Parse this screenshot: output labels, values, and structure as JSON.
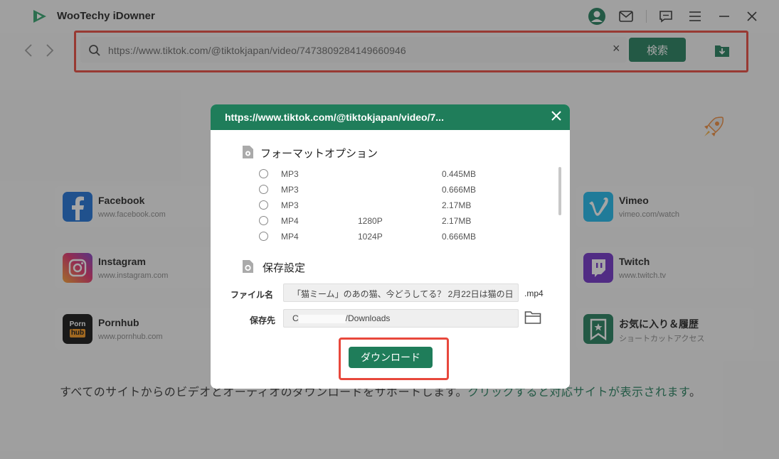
{
  "app": {
    "title": "WooTechy iDowner"
  },
  "colors": {
    "accent": "#1f7d5a",
    "highlight": "#e8483c"
  },
  "search": {
    "value": "https://www.tiktok.com/@tiktokjapan/video/7473809284149660946",
    "button_label": "検索"
  },
  "sites": [
    {
      "name": "Facebook",
      "url": "www.facebook.com",
      "icon": "facebook-icon"
    },
    {
      "name": "Instagram",
      "url": "www.instagram.com",
      "icon": "instagram-icon"
    },
    {
      "name": "Pornhub",
      "url": "www.pornhub.com",
      "icon": "pornhub-icon",
      "logo_top": "Porn",
      "logo_bottom": "hub"
    },
    {
      "name": "Vimeo",
      "url": "vimeo.com/watch",
      "icon": "vimeo-icon"
    },
    {
      "name": "Twitch",
      "url": "www.twitch.tv",
      "icon": "twitch-icon"
    },
    {
      "name": "お気に入り＆履歴",
      "url": "ショートカットアクセス",
      "icon": "bookmark-icon"
    }
  ],
  "footer": {
    "text": "すべてのサイトからのビデオとオーディオのダウンロードをサポートします。",
    "link_text": "クリックすると対応サイトが表示されます",
    "trailing": "。"
  },
  "modal": {
    "title": "https://www.tiktok.com/@tiktokjapan/video/7...",
    "format_section_title": "フォーマットオプション",
    "options": [
      {
        "format": "MP3",
        "resolution": "",
        "size": "0.445MB"
      },
      {
        "format": "MP3",
        "resolution": "",
        "size": "0.666MB"
      },
      {
        "format": "MP3",
        "resolution": "",
        "size": "2.17MB"
      },
      {
        "format": "MP4",
        "resolution": "1280P",
        "size": "2.17MB"
      },
      {
        "format": "MP4",
        "resolution": "1024P",
        "size": "0.666MB"
      }
    ],
    "save_section_title": "保存設定",
    "filename_label": "ファイル名",
    "filename_value": "「猫ミーム」のあの猫、今どうしてる？ 2月22日は猫の日",
    "filename_ext": ".mp4",
    "savepath_label": "保存先",
    "savepath_prefix": "C",
    "savepath_suffix": "/Downloads",
    "download_button": "ダウンロード"
  }
}
